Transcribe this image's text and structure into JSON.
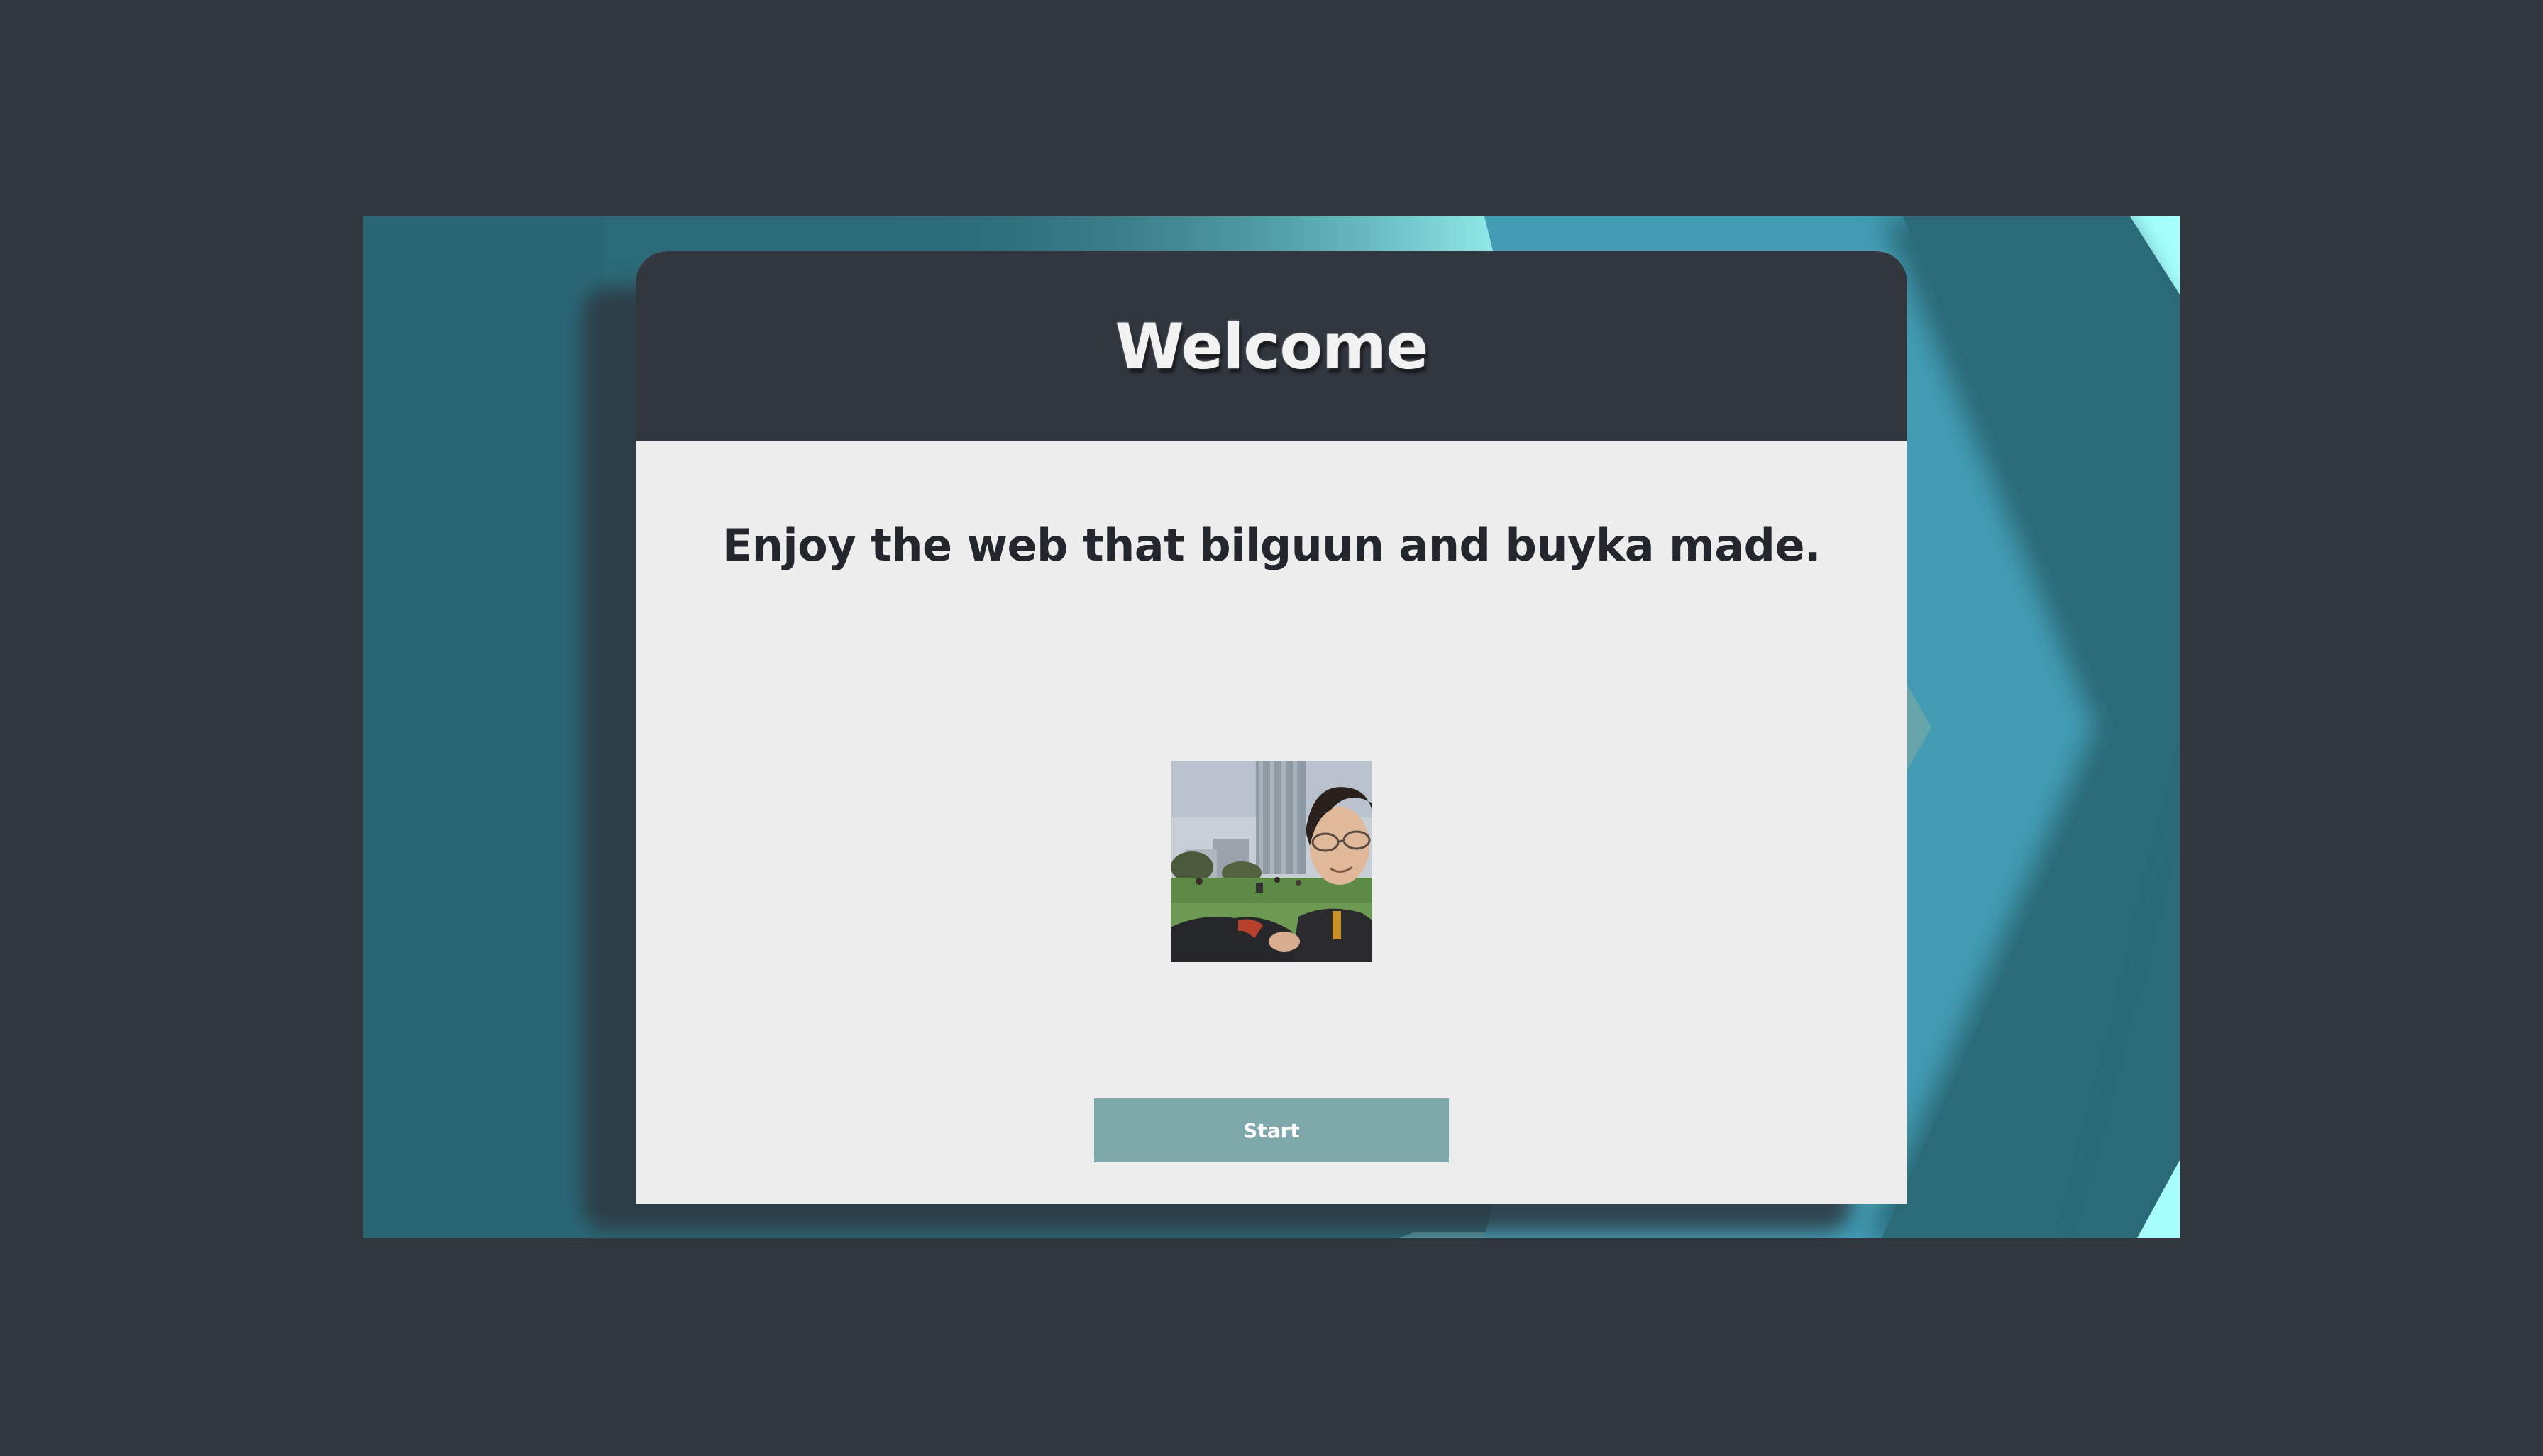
{
  "header": {
    "title": "Welcome"
  },
  "main": {
    "tagline": "Enjoy the web that bilguun and buyka made.",
    "photo_alt": "Selfie of a young man with glasses in a park with city buildings behind",
    "start_label": "Start"
  },
  "colors": {
    "page_background": "#32363f",
    "backdrop_teal": "#2b6a78",
    "backdrop_light_teal": "#439cb4",
    "backdrop_cyan": "#a6fffc",
    "card_header": "#32363f",
    "card_body": "#ededed",
    "button": "#7fa8ab",
    "tagline_text": "#23262d",
    "title_text": "#f2f2f2"
  }
}
